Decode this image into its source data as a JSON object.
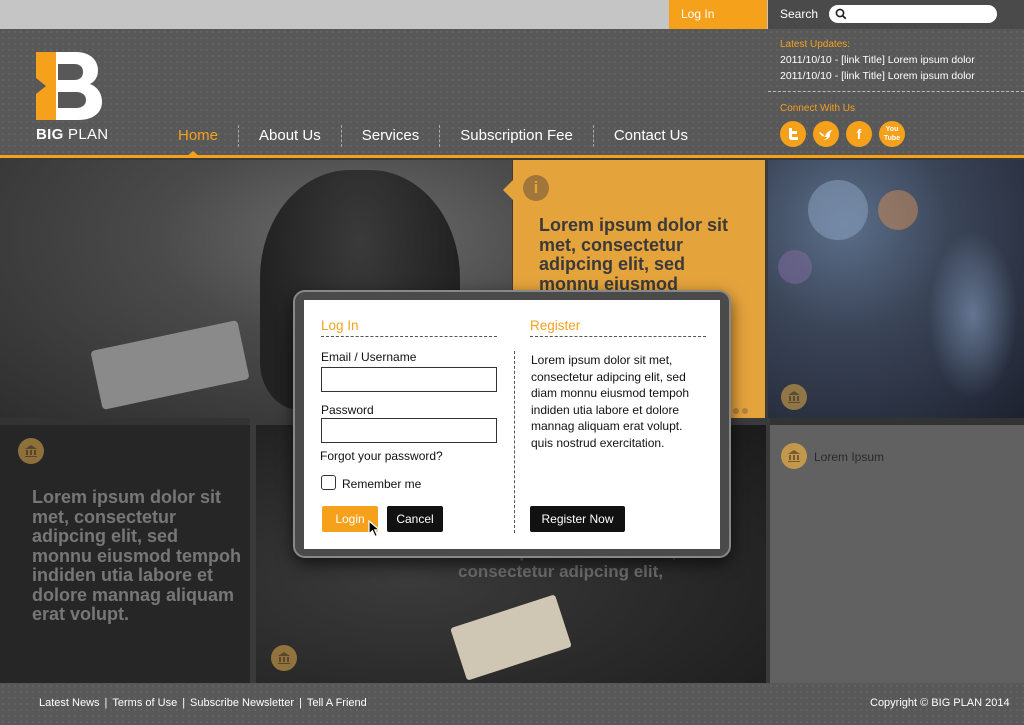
{
  "topbar": {
    "login_label": "Log In",
    "search_label": "Search",
    "search_placeholder": ""
  },
  "brand": {
    "name_bold": "BIG",
    "name_light": "PLAN",
    "accent_color": "#f5a11c"
  },
  "nav": {
    "items": [
      {
        "label": "Home",
        "active": true
      },
      {
        "label": "About Us",
        "active": false
      },
      {
        "label": "Services",
        "active": false
      },
      {
        "label": "Subscription Fee",
        "active": false
      },
      {
        "label": "Contact Us",
        "active": false
      }
    ]
  },
  "updates": {
    "title": "Latest Updates:",
    "items": [
      "2011/10/10 - [link Title] Lorem ipsum dolor",
      "2011/10/10 - [link Title] Lorem ipsum dolor"
    ]
  },
  "connect": {
    "title": "Connect With Us",
    "icons": [
      "twitter-icon",
      "bird-icon",
      "facebook-icon",
      "youtube-icon"
    ],
    "youtube_text": "You Tube",
    "facebook_text": "f"
  },
  "tiles": {
    "yellow_headline": "Lorem ipsum dolor sit met, consectetur adipcing elit, sed monnu eiusmod",
    "dark_headline": "Lorem ipsum dolor sit met, consectetur adipcing elit, sed monnu eiusmod tempoh indiden utia labore et dolore mannag aliquam erat volupt.",
    "photo_overtext": "Lorem ipsum dolor sit met, consectetur adipcing elit,",
    "gray_label": "Lorem Ipsum",
    "info_glyph": "i"
  },
  "modal": {
    "login_title": "Log In",
    "email_label": "Email / Username",
    "email_value": "",
    "password_label": "Password",
    "password_value": "",
    "forgot_label": "Forgot your password?",
    "remember_label": "Remember me",
    "remember_checked": false,
    "login_button": "Login",
    "cancel_button": "Cancel",
    "register_title": "Register",
    "register_text": "Lorem ipsum dolor sit met, consectetur adipcing elit, sed diam monnu eiusmod tempoh indiden utia labore et dolore mannag aliquam erat volupt. quis nostrud exercitation.",
    "register_button": "Register Now"
  },
  "footer": {
    "links": [
      "Latest News",
      "Terms of Use",
      "Subscribe Newsletter",
      "Tell A Friend"
    ],
    "separator": "|",
    "copyright": "Copyright © BIG PLAN 2014"
  }
}
